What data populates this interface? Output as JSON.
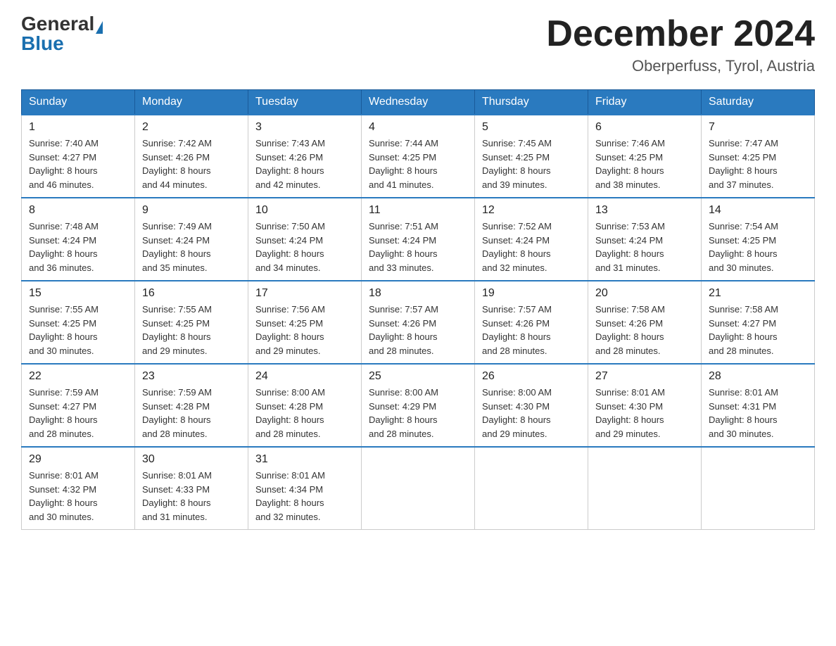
{
  "header": {
    "logo_general": "General",
    "logo_blue": "Blue",
    "month_title": "December 2024",
    "location": "Oberperfuss, Tyrol, Austria"
  },
  "days_of_week": [
    "Sunday",
    "Monday",
    "Tuesday",
    "Wednesday",
    "Thursday",
    "Friday",
    "Saturday"
  ],
  "weeks": [
    [
      {
        "day": "1",
        "sunrise": "7:40 AM",
        "sunset": "4:27 PM",
        "daylight": "8 hours and 46 minutes."
      },
      {
        "day": "2",
        "sunrise": "7:42 AM",
        "sunset": "4:26 PM",
        "daylight": "8 hours and 44 minutes."
      },
      {
        "day": "3",
        "sunrise": "7:43 AM",
        "sunset": "4:26 PM",
        "daylight": "8 hours and 42 minutes."
      },
      {
        "day": "4",
        "sunrise": "7:44 AM",
        "sunset": "4:25 PM",
        "daylight": "8 hours and 41 minutes."
      },
      {
        "day": "5",
        "sunrise": "7:45 AM",
        "sunset": "4:25 PM",
        "daylight": "8 hours and 39 minutes."
      },
      {
        "day": "6",
        "sunrise": "7:46 AM",
        "sunset": "4:25 PM",
        "daylight": "8 hours and 38 minutes."
      },
      {
        "day": "7",
        "sunrise": "7:47 AM",
        "sunset": "4:25 PM",
        "daylight": "8 hours and 37 minutes."
      }
    ],
    [
      {
        "day": "8",
        "sunrise": "7:48 AM",
        "sunset": "4:24 PM",
        "daylight": "8 hours and 36 minutes."
      },
      {
        "day": "9",
        "sunrise": "7:49 AM",
        "sunset": "4:24 PM",
        "daylight": "8 hours and 35 minutes."
      },
      {
        "day": "10",
        "sunrise": "7:50 AM",
        "sunset": "4:24 PM",
        "daylight": "8 hours and 34 minutes."
      },
      {
        "day": "11",
        "sunrise": "7:51 AM",
        "sunset": "4:24 PM",
        "daylight": "8 hours and 33 minutes."
      },
      {
        "day": "12",
        "sunrise": "7:52 AM",
        "sunset": "4:24 PM",
        "daylight": "8 hours and 32 minutes."
      },
      {
        "day": "13",
        "sunrise": "7:53 AM",
        "sunset": "4:24 PM",
        "daylight": "8 hours and 31 minutes."
      },
      {
        "day": "14",
        "sunrise": "7:54 AM",
        "sunset": "4:25 PM",
        "daylight": "8 hours and 30 minutes."
      }
    ],
    [
      {
        "day": "15",
        "sunrise": "7:55 AM",
        "sunset": "4:25 PM",
        "daylight": "8 hours and 30 minutes."
      },
      {
        "day": "16",
        "sunrise": "7:55 AM",
        "sunset": "4:25 PM",
        "daylight": "8 hours and 29 minutes."
      },
      {
        "day": "17",
        "sunrise": "7:56 AM",
        "sunset": "4:25 PM",
        "daylight": "8 hours and 29 minutes."
      },
      {
        "day": "18",
        "sunrise": "7:57 AM",
        "sunset": "4:26 PM",
        "daylight": "8 hours and 28 minutes."
      },
      {
        "day": "19",
        "sunrise": "7:57 AM",
        "sunset": "4:26 PM",
        "daylight": "8 hours and 28 minutes."
      },
      {
        "day": "20",
        "sunrise": "7:58 AM",
        "sunset": "4:26 PM",
        "daylight": "8 hours and 28 minutes."
      },
      {
        "day": "21",
        "sunrise": "7:58 AM",
        "sunset": "4:27 PM",
        "daylight": "8 hours and 28 minutes."
      }
    ],
    [
      {
        "day": "22",
        "sunrise": "7:59 AM",
        "sunset": "4:27 PM",
        "daylight": "8 hours and 28 minutes."
      },
      {
        "day": "23",
        "sunrise": "7:59 AM",
        "sunset": "4:28 PM",
        "daylight": "8 hours and 28 minutes."
      },
      {
        "day": "24",
        "sunrise": "8:00 AM",
        "sunset": "4:28 PM",
        "daylight": "8 hours and 28 minutes."
      },
      {
        "day": "25",
        "sunrise": "8:00 AM",
        "sunset": "4:29 PM",
        "daylight": "8 hours and 28 minutes."
      },
      {
        "day": "26",
        "sunrise": "8:00 AM",
        "sunset": "4:30 PM",
        "daylight": "8 hours and 29 minutes."
      },
      {
        "day": "27",
        "sunrise": "8:01 AM",
        "sunset": "4:30 PM",
        "daylight": "8 hours and 29 minutes."
      },
      {
        "day": "28",
        "sunrise": "8:01 AM",
        "sunset": "4:31 PM",
        "daylight": "8 hours and 30 minutes."
      }
    ],
    [
      {
        "day": "29",
        "sunrise": "8:01 AM",
        "sunset": "4:32 PM",
        "daylight": "8 hours and 30 minutes."
      },
      {
        "day": "30",
        "sunrise": "8:01 AM",
        "sunset": "4:33 PM",
        "daylight": "8 hours and 31 minutes."
      },
      {
        "day": "31",
        "sunrise": "8:01 AM",
        "sunset": "4:34 PM",
        "daylight": "8 hours and 32 minutes."
      },
      null,
      null,
      null,
      null
    ]
  ],
  "labels": {
    "sunrise": "Sunrise: ",
    "sunset": "Sunset: ",
    "daylight": "Daylight: "
  }
}
